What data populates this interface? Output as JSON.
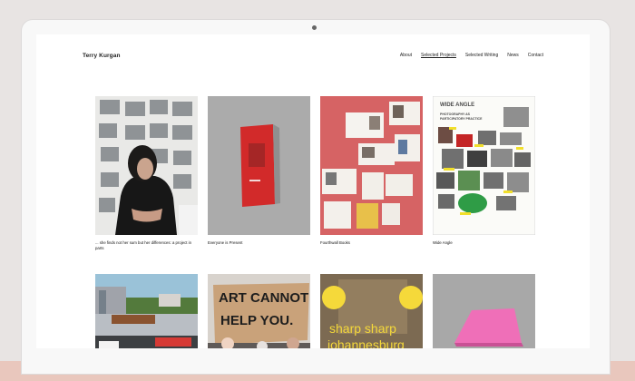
{
  "site": {
    "brand": "Terry Kurgan",
    "nav": [
      "About",
      "Selected Projects",
      "Selected Writing",
      "News",
      "Contact"
    ],
    "active_nav": "Selected Projects"
  },
  "projects": [
    {
      "title": "... she finds not her sum but her differences: a project in parts"
    },
    {
      "title": "Everyone is Present"
    },
    {
      "title": "Fourthwall Books"
    },
    {
      "title": "Wide Angle"
    }
  ],
  "thumb_text": {
    "wide_angle_title": "WIDE ANGLE",
    "wide_angle_sub_1": "PHOTOGRAPHY AS",
    "wide_angle_sub_2": "PARTICIPATORY PRACTICE",
    "protest_1": "ART CANNOT",
    "protest_2": "HELP YOU.",
    "sharp_1": "sharp sharp",
    "sharp_2": "johannesburg"
  },
  "colors": {
    "bezel": "#f8f8f8",
    "background": "#e8e4e3",
    "band": "#e9c7bd",
    "fourthwall_red": "#d66364",
    "sharp_yellow": "#f5d93a",
    "pink_book": "#ef6fb8"
  }
}
